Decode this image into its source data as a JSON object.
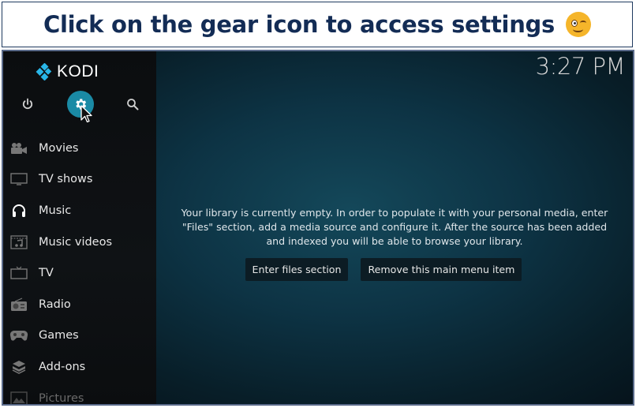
{
  "banner": {
    "text": "Click on the gear icon to access settings",
    "emoji": "winking-face"
  },
  "app": {
    "name": "KODI",
    "clock": "3:27 PM",
    "accent_color": "#1a8aa5"
  },
  "top_icons": [
    {
      "name": "power-icon"
    },
    {
      "name": "gear-icon",
      "highlighted": true
    },
    {
      "name": "search-icon"
    }
  ],
  "sidebar": {
    "items": [
      {
        "label": "Movies",
        "icon": "movie-camera-icon"
      },
      {
        "label": "TV shows",
        "icon": "tv-screen-icon"
      },
      {
        "label": "Music",
        "icon": "headphones-icon",
        "active": true
      },
      {
        "label": "Music videos",
        "icon": "music-video-icon"
      },
      {
        "label": "TV",
        "icon": "tv-antenna-icon"
      },
      {
        "label": "Radio",
        "icon": "radio-icon"
      },
      {
        "label": "Games",
        "icon": "gamepad-icon"
      },
      {
        "label": "Add-ons",
        "icon": "addons-box-icon"
      },
      {
        "label": "Pictures",
        "icon": "picture-icon"
      }
    ]
  },
  "main": {
    "message": "Your library is currently empty. In order to populate it with your personal media, enter \"Files\" section, add a media source and configure it. After the source has been added and indexed you will be able to browse your library.",
    "buttons": {
      "enter_files": "Enter files section",
      "remove_item": "Remove this main menu item"
    }
  }
}
